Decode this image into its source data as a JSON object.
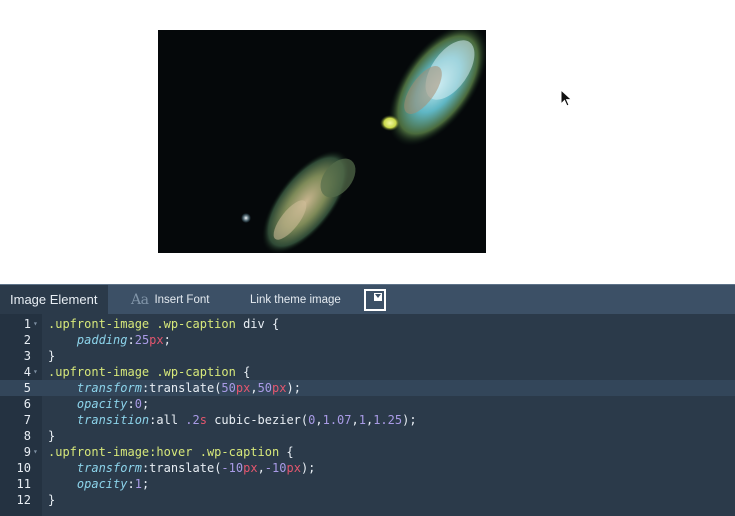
{
  "toolbar": {
    "active_tab": "Image Element",
    "insert_font_icon": "Aa",
    "insert_font_label": "Insert Font",
    "link_theme_label": "Link theme image",
    "theme_image_icon": "image-dropdown-icon"
  },
  "code_lines": [
    {
      "n": "1",
      "tokens": [
        {
          "t": "sel",
          "v": ".upfront-image .wp-caption "
        },
        {
          "t": "fn",
          "v": "div"
        },
        {
          "t": "punc",
          "v": " {"
        }
      ]
    },
    {
      "n": "2",
      "tokens": [
        {
          "t": "punc",
          "v": "    "
        },
        {
          "t": "prop",
          "v": "padding"
        },
        {
          "t": "punc",
          "v": ":"
        },
        {
          "t": "num-v",
          "v": "25"
        },
        {
          "t": "unit",
          "v": "px"
        },
        {
          "t": "punc",
          "v": ";"
        }
      ]
    },
    {
      "n": "3",
      "tokens": [
        {
          "t": "punc",
          "v": "}"
        }
      ]
    },
    {
      "n": "4",
      "tokens": [
        {
          "t": "sel",
          "v": ".upfront-image .wp-caption"
        },
        {
          "t": "punc",
          "v": " {"
        }
      ]
    },
    {
      "n": "5",
      "tokens": [
        {
          "t": "punc",
          "v": "    "
        },
        {
          "t": "prop",
          "v": "transform"
        },
        {
          "t": "punc",
          "v": ":"
        },
        {
          "t": "fn",
          "v": "translate("
        },
        {
          "t": "num-v",
          "v": "50"
        },
        {
          "t": "unit",
          "v": "px"
        },
        {
          "t": "punc",
          "v": ","
        },
        {
          "t": "num-v",
          "v": "50"
        },
        {
          "t": "unit",
          "v": "px"
        },
        {
          "t": "punc",
          "v": ");"
        }
      ]
    },
    {
      "n": "6",
      "tokens": [
        {
          "t": "punc",
          "v": "    "
        },
        {
          "t": "prop",
          "v": "opacity"
        },
        {
          "t": "punc",
          "v": ":"
        },
        {
          "t": "num-v",
          "v": "0"
        },
        {
          "t": "punc",
          "v": ";"
        }
      ]
    },
    {
      "n": "7",
      "tokens": [
        {
          "t": "punc",
          "v": "    "
        },
        {
          "t": "prop",
          "v": "transition"
        },
        {
          "t": "punc",
          "v": ":all "
        },
        {
          "t": "num-v",
          "v": ".2"
        },
        {
          "t": "unit",
          "v": "s"
        },
        {
          "t": "punc",
          "v": " cubic-bezier("
        },
        {
          "t": "num-v",
          "v": "0"
        },
        {
          "t": "punc",
          "v": ","
        },
        {
          "t": "num-v",
          "v": "1.07"
        },
        {
          "t": "punc",
          "v": ","
        },
        {
          "t": "num-v",
          "v": "1"
        },
        {
          "t": "punc",
          "v": ","
        },
        {
          "t": "num-v",
          "v": "1.25"
        },
        {
          "t": "punc",
          "v": ");"
        }
      ]
    },
    {
      "n": "8",
      "tokens": [
        {
          "t": "punc",
          "v": "}"
        }
      ]
    },
    {
      "n": "9",
      "tokens": [
        {
          "t": "sel",
          "v": ".upfront-image:hover .wp-caption"
        },
        {
          "t": "punc",
          "v": " {"
        }
      ]
    },
    {
      "n": "10",
      "tokens": [
        {
          "t": "punc",
          "v": "    "
        },
        {
          "t": "prop",
          "v": "transform"
        },
        {
          "t": "punc",
          "v": ":"
        },
        {
          "t": "fn",
          "v": "translate("
        },
        {
          "t": "num-v",
          "v": "-10"
        },
        {
          "t": "unit",
          "v": "px"
        },
        {
          "t": "punc",
          "v": ","
        },
        {
          "t": "num-v",
          "v": "-10"
        },
        {
          "t": "unit",
          "v": "px"
        },
        {
          "t": "punc",
          "v": ");"
        }
      ]
    },
    {
      "n": "11",
      "tokens": [
        {
          "t": "punc",
          "v": "    "
        },
        {
          "t": "prop",
          "v": "opacity"
        },
        {
          "t": "punc",
          "v": ":"
        },
        {
          "t": "num-v",
          "v": "1"
        },
        {
          "t": "punc",
          "v": ";"
        }
      ]
    },
    {
      "n": "12",
      "tokens": [
        {
          "t": "punc",
          "v": "}"
        }
      ]
    }
  ],
  "fold_lines": [
    "1",
    "4",
    "9"
  ],
  "active_line": "5",
  "colors": {
    "selector": "#d7e87a",
    "property": "#8cd3ea",
    "unit": "#e2566e",
    "number": "#a99be6",
    "editor_bg": "#2b3a4a",
    "toolbar_bg": "#3c5066"
  }
}
